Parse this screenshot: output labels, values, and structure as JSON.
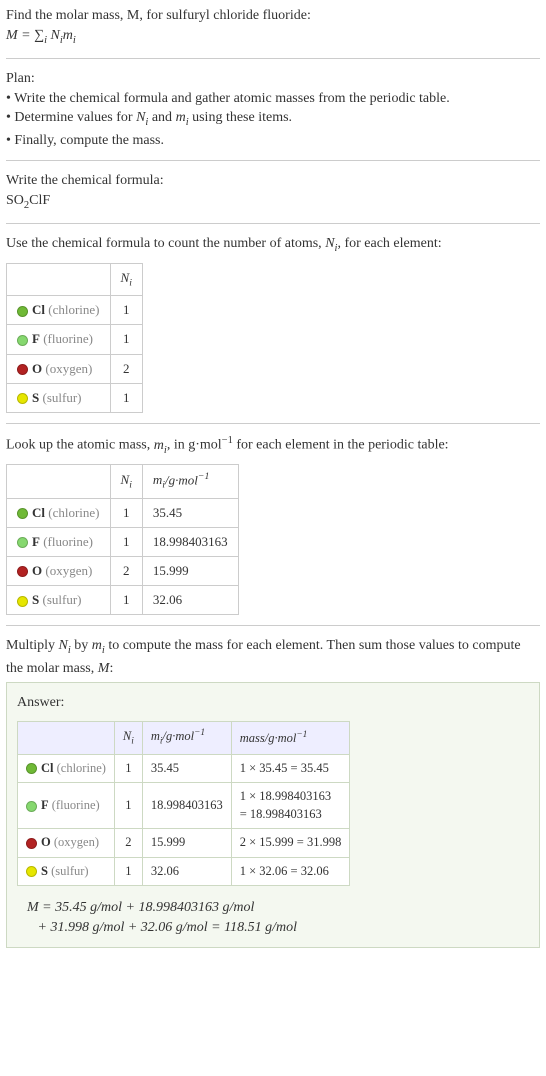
{
  "intro": {
    "line1": "Find the molar mass, M, for sulfuryl chloride fluoride:",
    "eq_html": "M = ∑<sub>i</sub> N<sub>i</sub>m<sub>i</sub>"
  },
  "plan": {
    "heading": "Plan:",
    "b1": "• Write the chemical formula and gather atomic masses from the periodic table.",
    "b2_html": "• Determine values for <i>N<sub>i</sub></i> and <i>m<sub>i</sub></i> using these items.",
    "b3": "• Finally, compute the mass."
  },
  "formula": {
    "heading": "Write the chemical formula:",
    "value_html": "SO<sub style='font-style:normal'>2</sub>ClF"
  },
  "count": {
    "heading_html": "Use the chemical formula to count the number of atoms, <i>N<sub>i</sub></i>, for each element:",
    "header_ni_html": "<i>N<sub>i</sub></i>",
    "rows": {
      "cl": {
        "sym": "Cl",
        "name": "(chlorine)",
        "n": "1"
      },
      "f": {
        "sym": "F",
        "name": "(fluorine)",
        "n": "1"
      },
      "o": {
        "sym": "O",
        "name": "(oxygen)",
        "n": "2"
      },
      "s": {
        "sym": "S",
        "name": "(sulfur)",
        "n": "1"
      }
    }
  },
  "masses": {
    "heading_html": "Look up the atomic mass, <i>m<sub>i</sub></i>, in g·mol<sup>−1</sup> for each element in the periodic table:",
    "header_mi_html": "<i>m<sub>i</sub></i>/g·mol<sup>−1</sup>",
    "rows": {
      "cl": {
        "m": "35.45"
      },
      "f": {
        "m": "18.998403163"
      },
      "o": {
        "m": "15.999"
      },
      "s": {
        "m": "32.06"
      }
    }
  },
  "multiply": {
    "heading_html": "Multiply <i>N<sub>i</sub></i> by <i>m<sub>i</sub></i> to compute the mass for each element. Then sum those values to compute the molar mass, <i>M</i>:"
  },
  "answer": {
    "label": "Answer:",
    "header_mass_html": "mass/g·mol<sup>−1</sup>",
    "rows": {
      "cl": {
        "calc": "1 × 35.45 = 35.45"
      },
      "f": {
        "calc_html": "1 × 18.998403163<br>= 18.998403163"
      },
      "o": {
        "calc": "2 × 15.999 = 31.998"
      },
      "s": {
        "calc": "1 × 32.06 = 32.06"
      }
    },
    "final_html": "M = 35.45 g/mol + 18.998403163 g/mol<br>&nbsp;&nbsp;&nbsp;+ 31.998 g/mol + 32.06 g/mol = 118.51 g/mol"
  }
}
